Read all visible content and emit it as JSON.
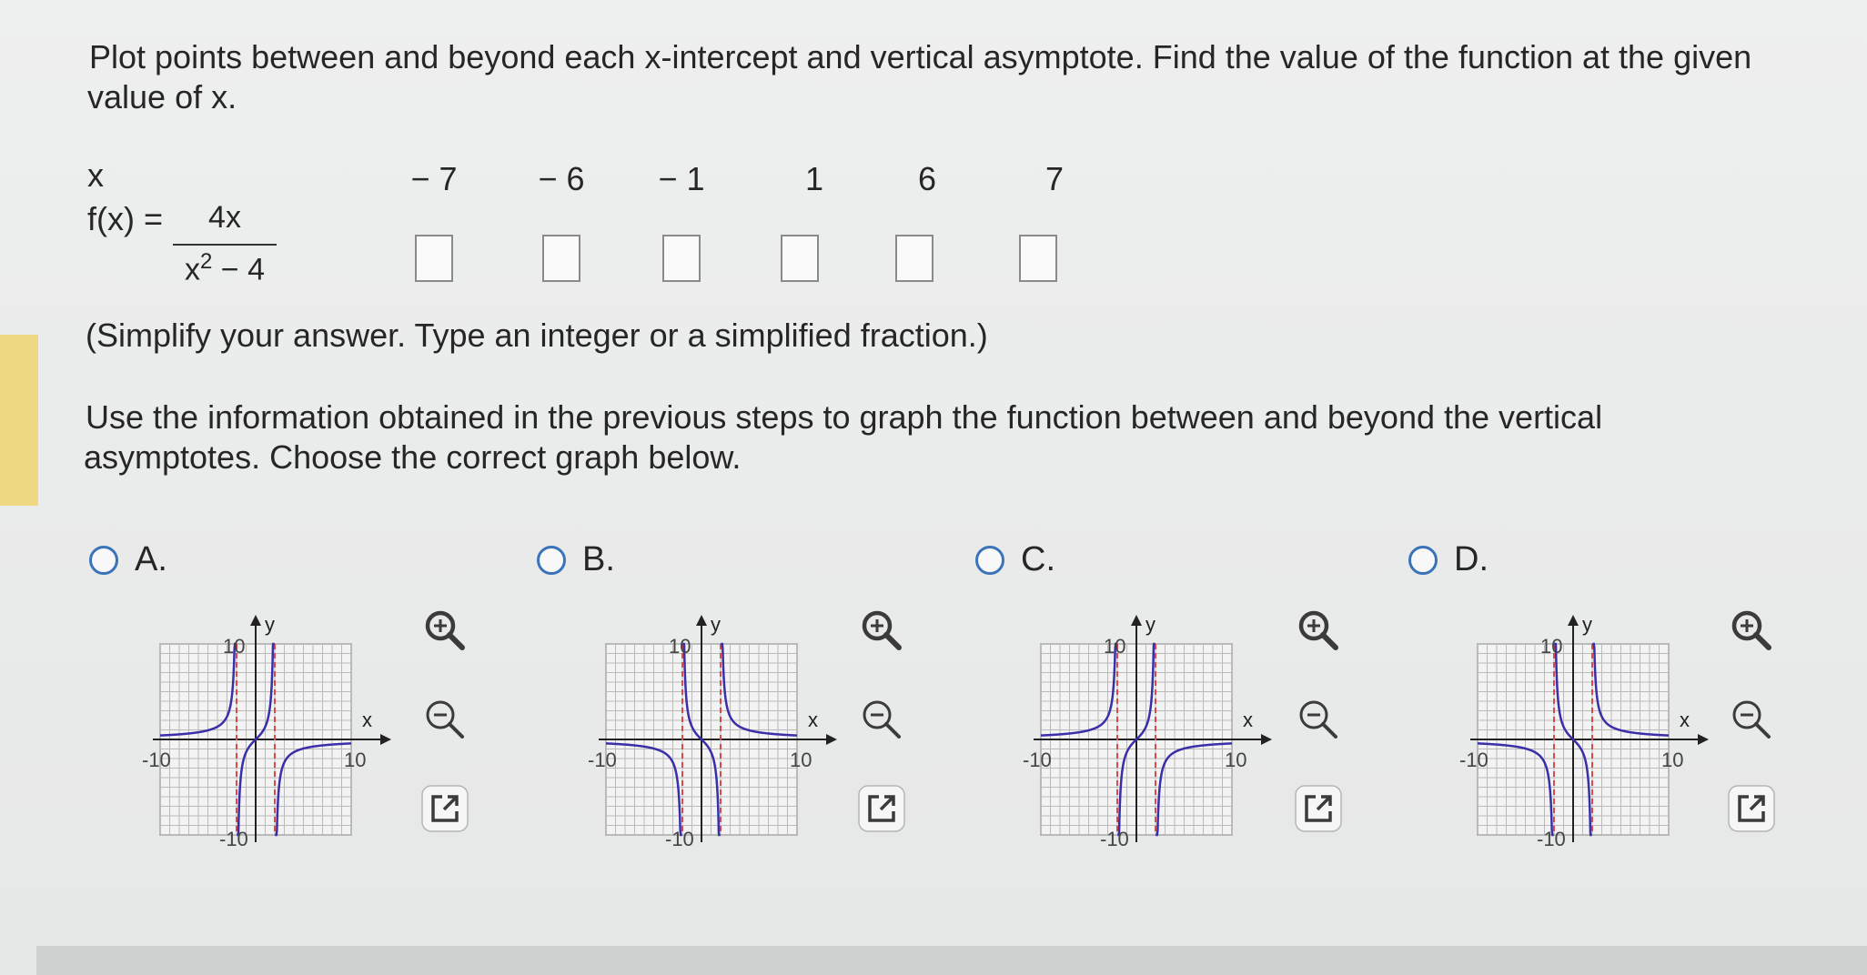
{
  "instructions": {
    "line1": "Plot points between and beyond each x-intercept and vertical asymptote. Find the value of the function at the given",
    "line2": "value of x."
  },
  "table": {
    "x_label": "x",
    "fx_label": "f(x) =",
    "numerator": "4x",
    "denominator_base": "x",
    "denominator_exp": "2",
    "denominator_rest": " − 4",
    "x_values": [
      "− 7",
      "− 6",
      "− 1",
      "1",
      "6",
      "7"
    ],
    "answers": [
      "",
      "",
      "",
      "",
      "",
      ""
    ]
  },
  "hint": "(Simplify your answer. Type an integer or a simplified fraction.)",
  "graph_instructions": {
    "line1": "Use the information obtained in the previous steps to graph the function between and beyond the vertical",
    "line2": "asymptotes. Choose the correct graph below."
  },
  "choices": [
    {
      "letter": "A.",
      "selected": false
    },
    {
      "letter": "B.",
      "selected": false
    },
    {
      "letter": "C.",
      "selected": false
    },
    {
      "letter": "D.",
      "selected": false
    }
  ],
  "graph_labels": {
    "y": "y",
    "x": "x",
    "ymax": "10",
    "ymin": "-10",
    "xmin": "-10",
    "xmax": "10"
  },
  "colors": {
    "accent": "#3a73b8",
    "curve": "#3a2fa8",
    "asymptote": "#d94a4a",
    "highlight": "#efd882"
  },
  "icons": [
    "zoom-in-icon",
    "zoom-out-icon",
    "open-external-icon"
  ]
}
